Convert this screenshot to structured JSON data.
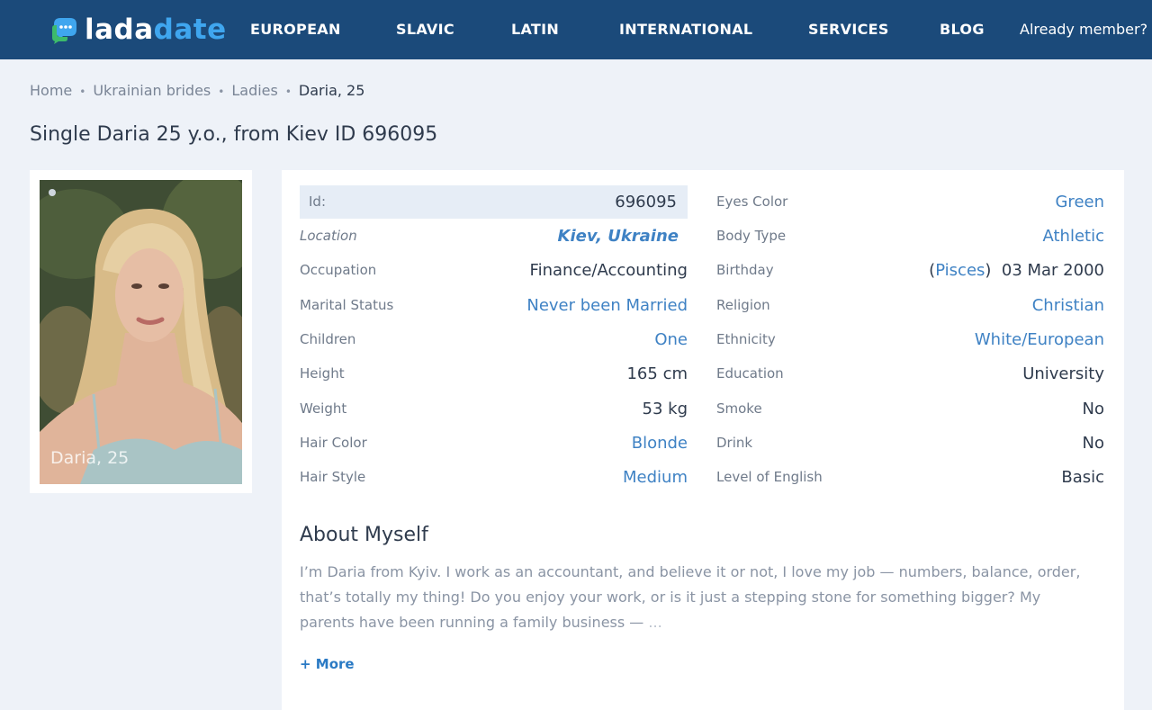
{
  "header": {
    "logo_a": "lada",
    "logo_b": "date",
    "nav": [
      "EUROPEAN",
      "SLAVIC",
      "LATIN",
      "INTERNATIONAL",
      "SERVICES",
      "BLOG"
    ],
    "already_member": "Already member?"
  },
  "breadcrumb": [
    "Home",
    "Ukrainian brides",
    "Ladies",
    "Daria, 25"
  ],
  "page_title": "Single Daria 25 y.o., from Kiev ID 696095",
  "photo": {
    "caption": "Daria, 25"
  },
  "left_fields": [
    {
      "label": "Id:",
      "value": "696095"
    },
    {
      "label": "Location",
      "value": "Kiev, Ukraine"
    },
    {
      "label": "Occupation",
      "value": "Finance/Accounting"
    },
    {
      "label": "Marital Status",
      "value": "Never been Married"
    },
    {
      "label": "Children",
      "value": "One"
    },
    {
      "label": "Height",
      "value": "165 cm"
    },
    {
      "label": "Weight",
      "value": "53 kg"
    },
    {
      "label": "Hair Color",
      "value": "Blonde"
    },
    {
      "label": "Hair Style",
      "value": "Medium"
    }
  ],
  "right_fields": [
    {
      "label": "Eyes Color",
      "value": "Green"
    },
    {
      "label": "Body Type",
      "value": "Athletic"
    },
    {
      "label": "Birthday",
      "sign": "Pisces",
      "value": "03 Mar 2000"
    },
    {
      "label": "Religion",
      "value": "Christian"
    },
    {
      "label": "Ethnicity",
      "value": "White/European"
    },
    {
      "label": "Education",
      "value": "University"
    },
    {
      "label": "Smoke",
      "value": "No"
    },
    {
      "label": "Drink",
      "value": "No"
    },
    {
      "label": "Level of English",
      "value": "Basic"
    }
  ],
  "about": {
    "heading": "About Myself",
    "text": "I’m Daria from Kyiv. I work as an accountant, and believe it or not, I love my job — numbers, balance, order, that’s totally my thing! Do you enjoy your work, or is it just a stepping stone for something bigger? My parents have been running a family business —",
    "ellipsis": "...",
    "more": "+ More"
  },
  "colors": {
    "header_bg": "#1b4a7a",
    "link": "#3f82c4",
    "page_bg": "#eef2f8"
  }
}
